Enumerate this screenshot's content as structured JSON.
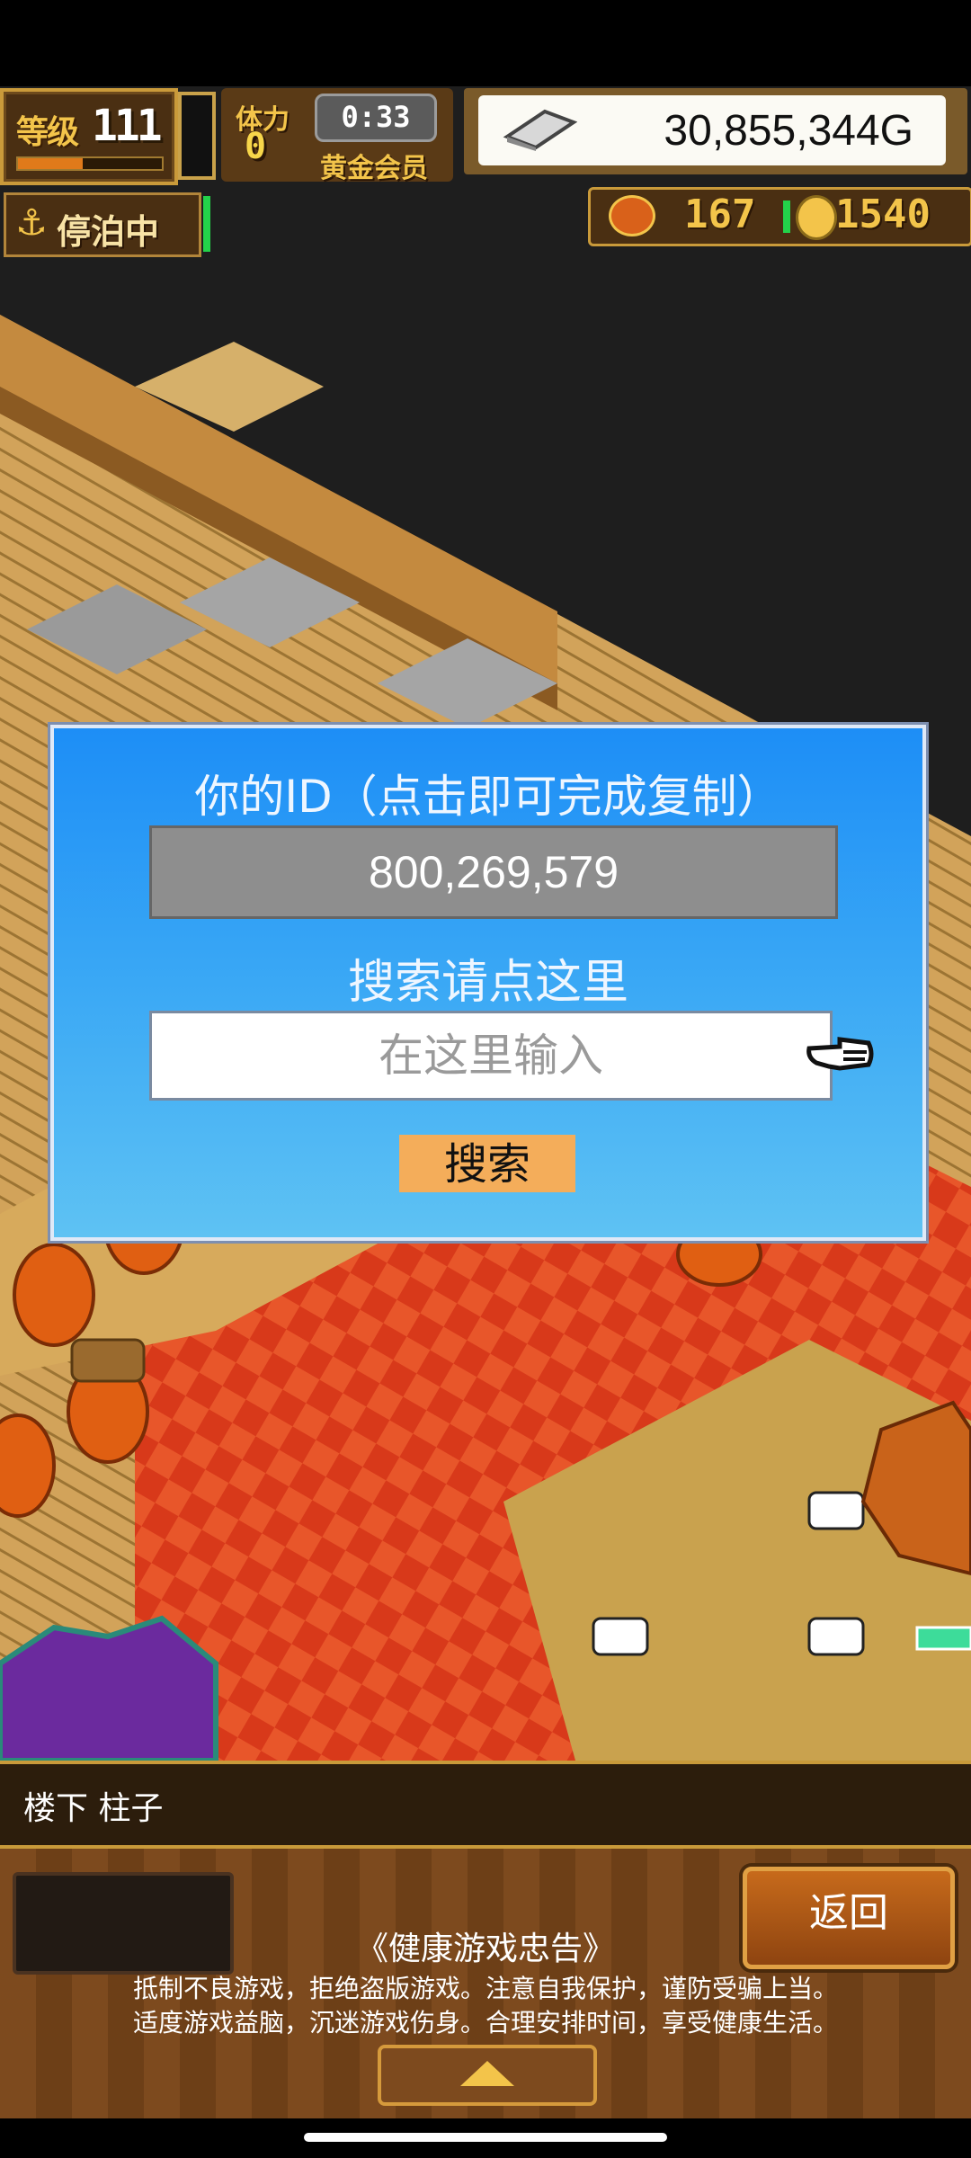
{
  "hud": {
    "level_label": "等级",
    "level_value": "111",
    "xp_progress": 0.45,
    "stamina_label": "体力",
    "stamina_value": "0",
    "timer": "0:33",
    "membership": "黄金会员",
    "money": "30,855,344G",
    "harbor_status": "停泊中",
    "food_count": "167",
    "coin_count": "1540"
  },
  "dialog": {
    "title": "你的ID（点击即可完成复制）",
    "user_id": "800,269,579",
    "search_hint": "搜索请点这里",
    "search_placeholder": "在这里输入",
    "search_button": "搜索"
  },
  "location": "楼下 柱子",
  "bottom": {
    "back_button": "返回",
    "advisory_title": "《健康游戏忠告》",
    "advisory_line1": "抵制不良游戏，拒绝盗版游戏。注意自我保护，谨防受骗上当。",
    "advisory_line2": "适度游戏益脑，沉迷游戏伤身。合理安排时间，享受健康生活。"
  },
  "colors": {
    "dialog_top": "#1d8ef6",
    "dialog_bottom": "#5ec2f3",
    "search_button": "#f4ad5a",
    "floor_red": "#d8391a",
    "wood": "#c99a3a"
  }
}
